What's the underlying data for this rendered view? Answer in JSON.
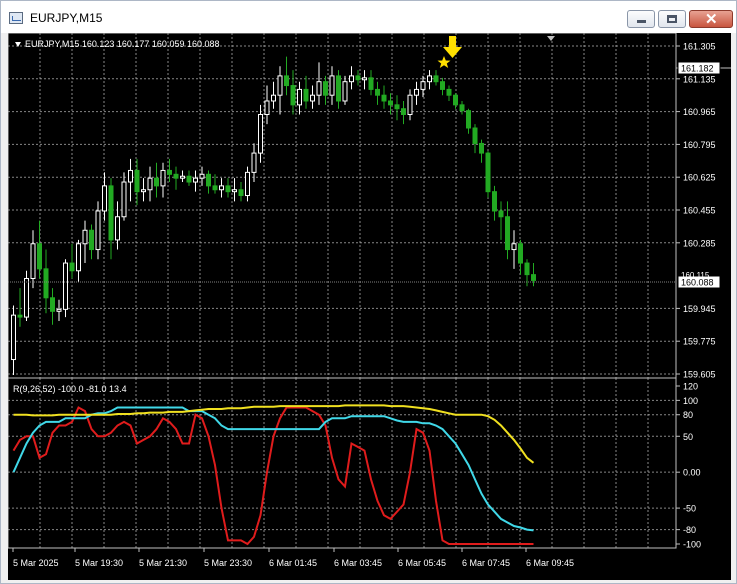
{
  "window": {
    "title": "EURJPY,M15"
  },
  "colors": {
    "background": "#000000",
    "grid": "#c0c0c0",
    "bull": "#ffffff",
    "bear": "#22aa22",
    "scale_text": "#ffffff",
    "ind_red": "#e01c1c",
    "ind_cyan": "#40d8e8",
    "ind_yellow": "#f0e020",
    "arrow": "#ffe000"
  },
  "icons": {
    "triangle": "chart-menu-triangle-icon",
    "arrow": "sell-arrow-icon",
    "star": "signal-star-icon"
  },
  "chart_data": [
    {
      "type": "candlestick",
      "symbol_header": "EURJPY,M15  160.123 160.177 160.059 160.088",
      "ylim": [
        159.605,
        161.305
      ],
      "y_ticks": [
        "161.305",
        "161.135",
        "160.965",
        "160.795",
        "160.625",
        "160.455",
        "160.285",
        "159.945",
        "159.775",
        "159.605"
      ],
      "current_price": "160.088",
      "hline_price": "161.182",
      "partial_tick": "160.115",
      "candles": [
        [
          159.68,
          159.96,
          159.6,
          159.91
        ],
        [
          159.91,
          160.05,
          159.85,
          159.9
        ],
        [
          159.9,
          160.14,
          159.88,
          160.1
        ],
        [
          160.1,
          160.35,
          160.05,
          160.28
        ],
        [
          160.28,
          160.4,
          160.1,
          160.15
        ],
        [
          160.15,
          160.25,
          159.92,
          160.0
        ],
        [
          160.0,
          160.05,
          159.86,
          159.93
        ],
        [
          159.93,
          159.99,
          159.88,
          159.94
        ],
        [
          159.94,
          160.2,
          159.9,
          160.18
        ],
        [
          160.18,
          160.28,
          160.1,
          160.14
        ],
        [
          160.14,
          160.3,
          160.08,
          160.28
        ],
        [
          160.28,
          160.4,
          160.18,
          160.35
        ],
        [
          160.35,
          160.38,
          160.2,
          160.25
        ],
        [
          160.25,
          160.5,
          160.2,
          160.45
        ],
        [
          160.45,
          160.65,
          160.4,
          160.58
        ],
        [
          160.58,
          160.62,
          160.2,
          160.3
        ],
        [
          160.3,
          160.5,
          160.25,
          160.42
        ],
        [
          160.42,
          160.65,
          160.4,
          160.6
        ],
        [
          160.6,
          160.72,
          160.5,
          160.66
        ],
        [
          160.66,
          160.72,
          160.48,
          160.55
        ],
        [
          160.55,
          160.62,
          160.5,
          160.56
        ],
        [
          160.56,
          160.68,
          160.5,
          160.62
        ],
        [
          160.62,
          160.7,
          160.52,
          160.58
        ],
        [
          160.58,
          160.7,
          160.52,
          160.66
        ],
        [
          160.66,
          160.72,
          160.6,
          160.64
        ],
        [
          160.64,
          160.68,
          160.56,
          160.62
        ],
        [
          160.62,
          160.66,
          160.6,
          160.63
        ],
        [
          160.63,
          160.66,
          160.58,
          160.6
        ],
        [
          160.6,
          160.66,
          160.55,
          160.62
        ],
        [
          160.62,
          160.68,
          160.58,
          160.64
        ],
        [
          160.64,
          160.66,
          160.54,
          160.58
        ],
        [
          160.58,
          160.64,
          160.54,
          160.56
        ],
        [
          160.56,
          160.62,
          160.52,
          160.58
        ],
        [
          160.58,
          160.62,
          160.52,
          160.55
        ],
        [
          160.55,
          160.62,
          160.5,
          160.56
        ],
        [
          160.56,
          160.6,
          160.5,
          160.53
        ],
        [
          160.53,
          160.68,
          160.5,
          160.65
        ],
        [
          160.65,
          160.8,
          160.6,
          160.75
        ],
        [
          160.75,
          161.0,
          160.7,
          160.95
        ],
        [
          160.95,
          161.1,
          160.9,
          161.02
        ],
        [
          161.02,
          161.12,
          160.98,
          161.05
        ],
        [
          161.05,
          161.2,
          160.95,
          161.15
        ],
        [
          161.15,
          161.25,
          161.05,
          161.1
        ],
        [
          161.1,
          161.18,
          160.95,
          161.0
        ],
        [
          161.0,
          161.12,
          160.95,
          161.08
        ],
        [
          161.08,
          161.15,
          160.98,
          161.02
        ],
        [
          161.02,
          161.1,
          160.98,
          161.05
        ],
        [
          161.05,
          161.22,
          161.0,
          161.12
        ],
        [
          161.12,
          161.15,
          161.0,
          161.05
        ],
        [
          161.05,
          161.2,
          161.0,
          161.15
        ],
        [
          161.15,
          161.18,
          160.98,
          161.02
        ],
        [
          161.02,
          161.15,
          161.0,
          161.12
        ],
        [
          161.12,
          161.2,
          161.08,
          161.15
        ],
        [
          161.15,
          161.18,
          161.1,
          161.13
        ],
        [
          161.13,
          161.18,
          161.08,
          161.14
        ],
        [
          161.14,
          161.18,
          161.05,
          161.08
        ],
        [
          161.08,
          161.12,
          161.0,
          161.05
        ],
        [
          161.05,
          161.1,
          160.98,
          161.02
        ],
        [
          161.02,
          161.06,
          160.95,
          161.0
        ],
        [
          161.0,
          161.05,
          160.92,
          160.98
        ],
        [
          160.98,
          161.02,
          160.9,
          160.95
        ],
        [
          160.95,
          161.08,
          160.92,
          161.05
        ],
        [
          161.05,
          161.12,
          161.0,
          161.08
        ],
        [
          161.08,
          161.15,
          161.04,
          161.12
        ],
        [
          161.12,
          161.18,
          161.08,
          161.15
        ],
        [
          161.15,
          161.18,
          161.1,
          161.12
        ],
        [
          161.12,
          161.14,
          161.05,
          161.08
        ],
        [
          161.08,
          161.1,
          161.02,
          161.05
        ],
        [
          161.05,
          161.06,
          160.98,
          161.0
        ],
        [
          161.0,
          161.02,
          160.95,
          160.97
        ],
        [
          160.97,
          160.98,
          160.85,
          160.88
        ],
        [
          160.88,
          160.9,
          160.75,
          160.8
        ],
        [
          160.8,
          160.82,
          160.7,
          160.75
        ],
        [
          160.75,
          160.76,
          160.52,
          160.55
        ],
        [
          160.55,
          160.58,
          160.4,
          160.45
        ],
        [
          160.45,
          160.5,
          160.3,
          160.42
        ],
        [
          160.42,
          160.5,
          160.2,
          160.25
        ],
        [
          160.25,
          160.35,
          160.15,
          160.28
        ],
        [
          160.28,
          160.3,
          160.12,
          160.18
        ],
        [
          160.18,
          160.2,
          160.06,
          160.12
        ],
        [
          160.12,
          160.18,
          160.06,
          160.09
        ]
      ]
    },
    {
      "type": "line",
      "header": "R(9,26,52) -100.0 -81.0 13.4",
      "ylim": [
        -100,
        120
      ],
      "y_ticks": [
        "120",
        "100",
        "80",
        "50",
        "0.00",
        "-50",
        "-80",
        "-100"
      ],
      "x_ticks": [
        "5 Mar 2025",
        "5 Mar 19:30",
        "5 Mar 21:30",
        "5 Mar 23:30",
        "6 Mar 01:45",
        "6 Mar 03:45",
        "6 Mar 05:45",
        "6 Mar 07:45",
        "6 Mar 09:45"
      ],
      "series": [
        {
          "values": [
            30,
            45,
            50,
            50,
            20,
            25,
            55,
            65,
            65,
            70,
            90,
            85,
            60,
            50,
            50,
            55,
            65,
            70,
            65,
            40,
            45,
            50,
            60,
            75,
            70,
            60,
            40,
            40,
            80,
            75,
            50,
            10,
            -50,
            -95,
            -95,
            -95,
            -100,
            -90,
            -60,
            0,
            50,
            75,
            90,
            90,
            90,
            90,
            85,
            80,
            65,
            20,
            -10,
            -20,
            40,
            35,
            30,
            -10,
            -40,
            -60,
            -65,
            -55,
            -45,
            0,
            60,
            55,
            30,
            -40,
            -95,
            -100,
            -100,
            -100,
            -100,
            -100,
            -100,
            -100,
            -100,
            -100,
            -100,
            -100,
            -100,
            -100,
            -100
          ]
        },
        {
          "values": [
            0,
            20,
            40,
            55,
            65,
            70,
            70,
            70,
            75,
            75,
            75,
            75,
            80,
            82,
            82,
            85,
            90,
            90,
            90,
            90,
            90,
            90,
            90,
            90,
            90,
            90,
            90,
            85,
            85,
            85,
            80,
            75,
            65,
            60,
            60,
            60,
            60,
            60,
            60,
            60,
            60,
            60,
            60,
            60,
            60,
            60,
            60,
            60,
            70,
            75,
            75,
            75,
            78,
            78,
            78,
            78,
            78,
            78,
            75,
            72,
            70,
            70,
            70,
            68,
            68,
            65,
            60,
            50,
            40,
            25,
            10,
            -10,
            -30,
            -45,
            -55,
            -65,
            -70,
            -75,
            -77,
            -80,
            -81
          ]
        },
        {
          "values": [
            80,
            80,
            80,
            79,
            79,
            79,
            79,
            80,
            80,
            80,
            80,
            80,
            80,
            80,
            80,
            80,
            81,
            81,
            81,
            82,
            82,
            83,
            83,
            83,
            84,
            84,
            84,
            85,
            86,
            87,
            88,
            88,
            88,
            89,
            89,
            89,
            90,
            91,
            91,
            91,
            91,
            92,
            92,
            92,
            92,
            92,
            92,
            92,
            92,
            92,
            92,
            93,
            93,
            93,
            93,
            93,
            93,
            93,
            92,
            92,
            92,
            91,
            90,
            89,
            88,
            86,
            84,
            82,
            80,
            80,
            80,
            80,
            80,
            78,
            73,
            65,
            55,
            45,
            33,
            20,
            13
          ]
        }
      ]
    }
  ]
}
